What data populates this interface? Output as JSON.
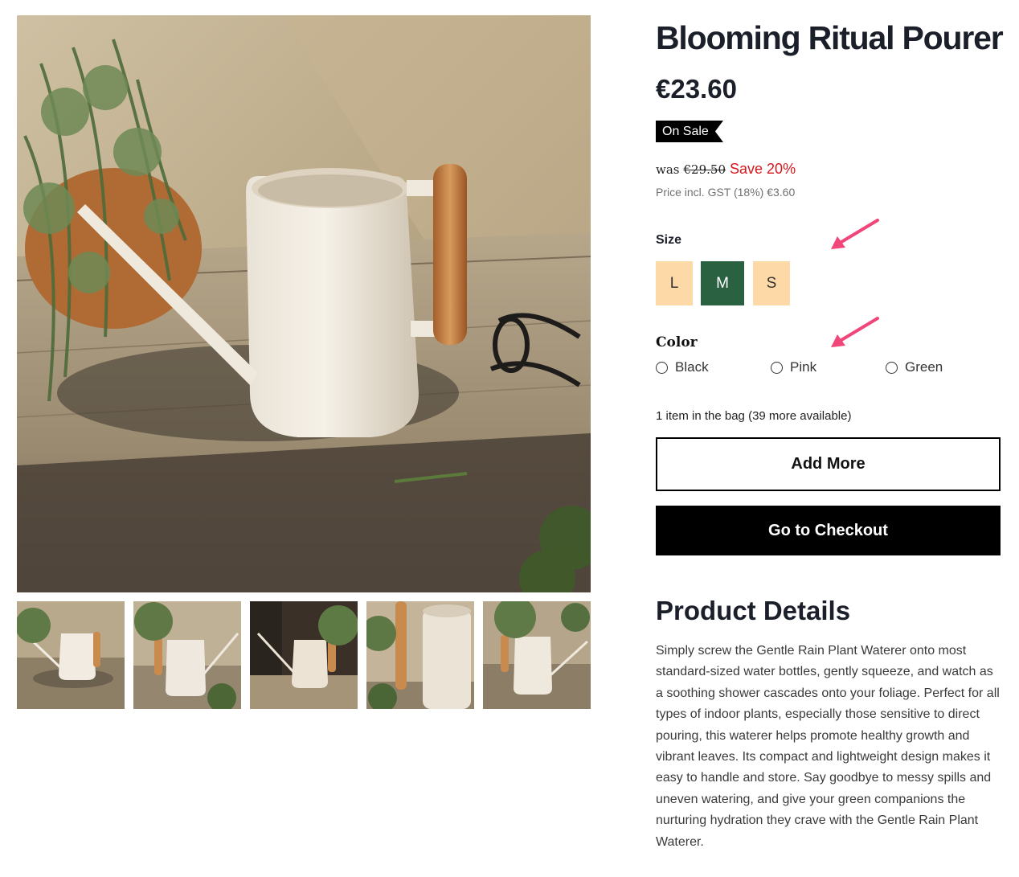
{
  "product": {
    "title": "Blooming Ritual Pourer",
    "price": "€23.60",
    "badge": "On Sale",
    "was_label": "was",
    "was_price": "€29.50",
    "save_text": "Save 20%",
    "tax_text": "Price incl. GST (18%) €3.60"
  },
  "size": {
    "label": "Size",
    "options": [
      "L",
      "M",
      "S"
    ],
    "selected": "M"
  },
  "color": {
    "label": "Color",
    "options": [
      "Black",
      "Pink",
      "Green"
    ]
  },
  "cart": {
    "status": "1 item in the bag (39 more available)",
    "add_more_label": "Add More",
    "checkout_label": "Go to Checkout"
  },
  "details": {
    "heading": "Product Details",
    "body": "Simply screw the Gentle Rain Plant Waterer onto most standard-sized water bottles, gently squeeze, and watch as a soothing shower cascades onto your foliage. Perfect for all types of indoor plants, especially those sensitive to direct pouring, this waterer helps promote healthy growth and vibrant leaves. Its compact and lightweight design makes it easy to handle and store. Say goodbye to messy spills and uneven watering, and give your green companions the nurturing hydration they crave with the Gentle Rain Plant Waterer."
  },
  "colors": {
    "accent_selected": "#2a6141",
    "size_unselected": "#fdd9a8",
    "sale_red": "#d8161d",
    "annotation_arrow": "#f2457a"
  },
  "gallery": {
    "thumbnail_count": 5
  }
}
